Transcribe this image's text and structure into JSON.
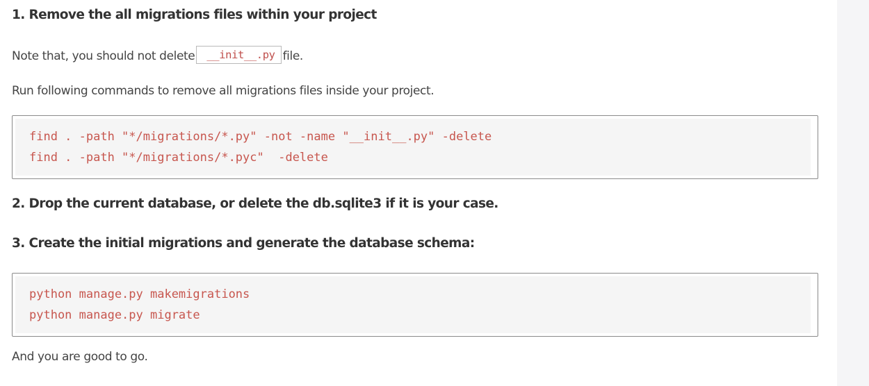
{
  "step1": {
    "heading": "1. Remove the all migrations files within your project",
    "note_before": "Note that, you should not delete",
    "note_code": "__init__.py",
    "note_after": "file.",
    "run_text": "Run following commands to remove all migrations files inside your project.",
    "commands": [
      "find . -path \"*/migrations/*.py\" -not -name \"__init__.py\" -delete",
      "find . -path \"*/migrations/*.pyc\"  -delete"
    ]
  },
  "step2": {
    "heading": "2. Drop the current database, or delete the db.sqlite3 if it is your case."
  },
  "step3": {
    "heading": "3. Create the initial migrations and generate the database schema:",
    "commands": [
      "python manage.py makemigrations",
      "python manage.py migrate"
    ]
  },
  "closing": "And you are good to go.",
  "colors": {
    "code_text": "#c7564e",
    "code_background": "#f5f5f5",
    "frame_border": "#8a8a8a"
  }
}
